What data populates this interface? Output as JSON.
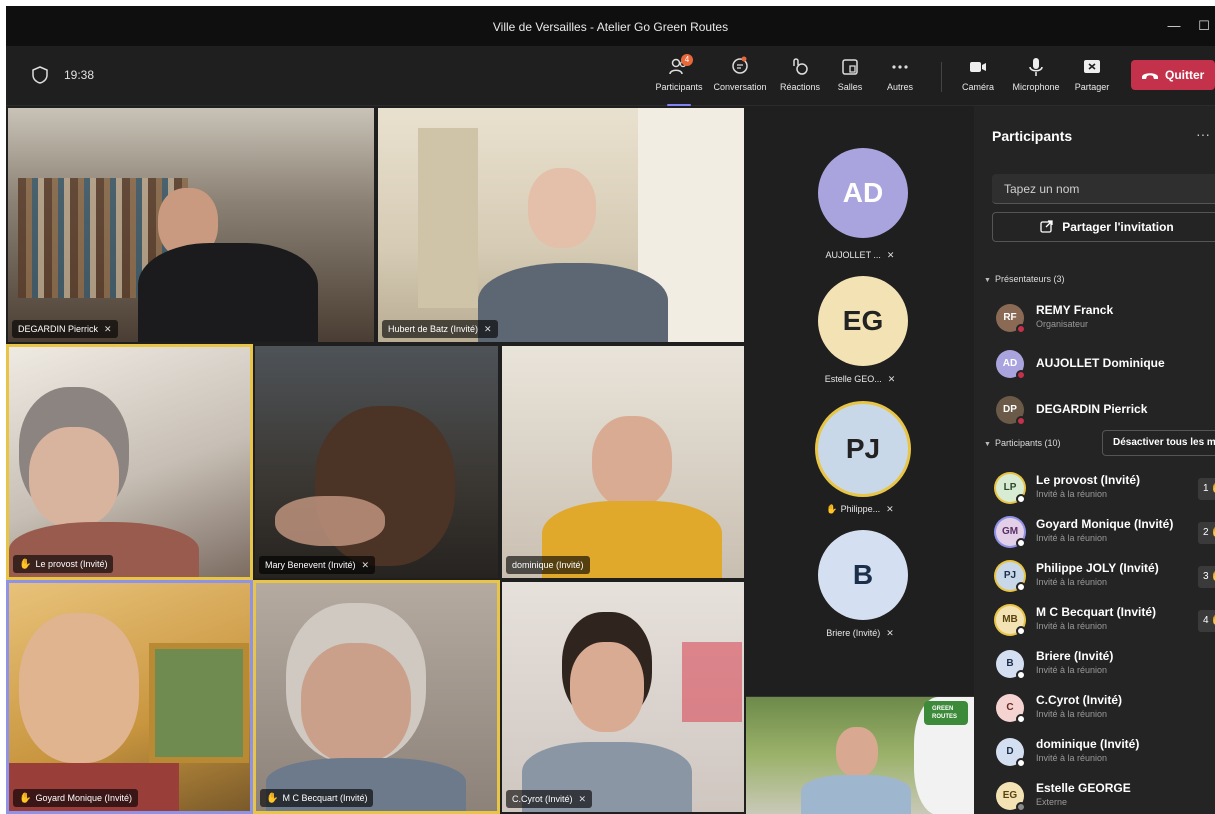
{
  "window": {
    "title": "Ville de Versailles - Atelier Go Green Routes",
    "minimize": "—",
    "maximize": "☐"
  },
  "toolbar": {
    "time": "19:38",
    "participants_label": "Participants",
    "participants_badge": "4",
    "conversation_label": "Conversation",
    "reactions_label": "Réactions",
    "rooms_label": "Salles",
    "more_label": "Autres",
    "camera_label": "Caméra",
    "microphone_label": "Microphone",
    "share_label": "Partager",
    "quit_label": "Quitter"
  },
  "stage": {
    "tiles": [
      {
        "name": "DEGARDIN Pierrick"
      },
      {
        "name": "Hubert de Batz (Invité)"
      },
      {
        "name": "Le provost (Invité)"
      },
      {
        "name": "Mary Benevent (Invité)"
      },
      {
        "name": "dominique (Invité)"
      },
      {
        "name": "Goyard Monique (Invité)"
      },
      {
        "name": "M C Becquart (Invité)"
      },
      {
        "name": "C.Cyrot (Invité)"
      }
    ],
    "avatars": [
      {
        "initials": "AD",
        "name": "AUJOLLET ...",
        "color": "#a9a4de"
      },
      {
        "initials": "EG",
        "name": "Estelle GEO...",
        "color": "#f3e3b4"
      },
      {
        "initials": "PJ",
        "name": "Philippe...",
        "color": "#c9d8e8"
      },
      {
        "initials": "B",
        "name": "Briere (Invité)",
        "color": "#d4e0f2"
      }
    ],
    "selfview_logo": "GREEN ROUTES"
  },
  "panel": {
    "title": "Participants",
    "more": "···",
    "search_placeholder": "Tapez un nom",
    "invite_label": "Partager l'invitation",
    "presenters_heading": "Présentateurs (3)",
    "attendees_heading": "Participants (10)",
    "mute_all_label": "Désactiver tous les m",
    "presenters": [
      {
        "initials": "RF",
        "name": "REMY Franck",
        "sub": "Organisateur",
        "color": "#8a6a55"
      },
      {
        "initials": "AD",
        "name": "AUJOLLET Dominique",
        "sub": "",
        "color": "#a9a4de"
      },
      {
        "initials": "DP",
        "name": "DEGARDIN Pierrick",
        "sub": "",
        "color": "#6b5a48"
      }
    ],
    "attendees": [
      {
        "initials": "LP",
        "name": "Le provost (Invité)",
        "sub": "Invité à la réunion",
        "order": "1",
        "color": "#d8ecd4"
      },
      {
        "initials": "GM",
        "name": "Goyard Monique (Invité)",
        "sub": "Invité à la réunion",
        "order": "2",
        "color": "#e3d0e8"
      },
      {
        "initials": "PJ",
        "name": "Philippe JOLY (Invité)",
        "sub": "Invité à la réunion",
        "order": "3",
        "color": "#c9d8e8"
      },
      {
        "initials": "MB",
        "name": "M C Becquart (Invité)",
        "sub": "Invité à la réunion",
        "order": "4",
        "color": "#f3e3b4"
      },
      {
        "initials": "B",
        "name": "Briere (Invité)",
        "sub": "Invité à la réunion",
        "order": "",
        "color": "#d4e0f2"
      },
      {
        "initials": "C",
        "name": "C.Cyrot (Invité)",
        "sub": "Invité à la réunion",
        "order": "",
        "color": "#f4d3d0"
      },
      {
        "initials": "D",
        "name": "dominique (Invité)",
        "sub": "Invité à la réunion",
        "order": "",
        "color": "#d4e0f2"
      },
      {
        "initials": "EG",
        "name": "Estelle GEORGE",
        "sub": "Externe",
        "order": "",
        "color": "#f3e3b4"
      }
    ]
  }
}
